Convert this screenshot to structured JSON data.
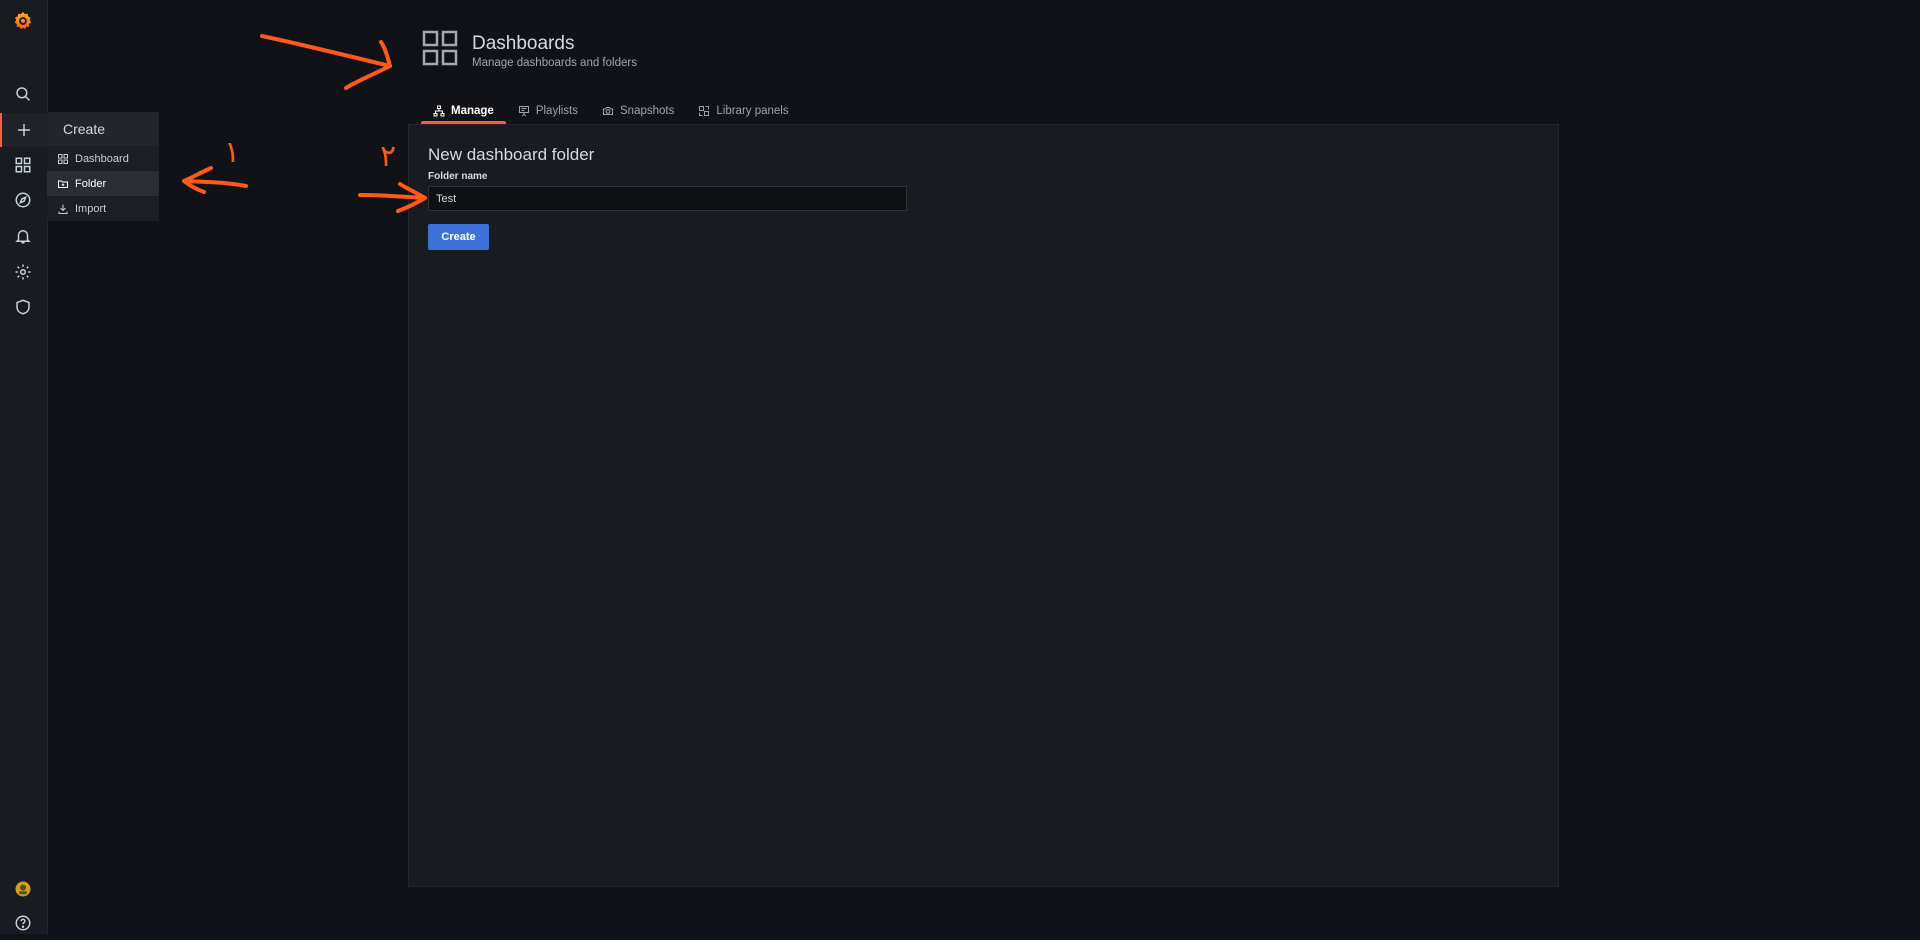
{
  "sidemenu": {
    "items": [
      {
        "name": "search",
        "icon": "search-icon"
      },
      {
        "name": "create",
        "icon": "plus-icon"
      },
      {
        "name": "dashboards",
        "icon": "apps-icon"
      },
      {
        "name": "explore",
        "icon": "compass-icon"
      },
      {
        "name": "alerting",
        "icon": "bell-icon"
      },
      {
        "name": "configuration",
        "icon": "gear-icon"
      },
      {
        "name": "server-admin",
        "icon": "shield-icon"
      }
    ],
    "accent": "#f55f3e"
  },
  "flyout": {
    "header": "Create",
    "items": [
      {
        "label": "Dashboard",
        "icon": "apps-icon"
      },
      {
        "label": "Folder",
        "icon": "folder-plus-icon"
      },
      {
        "label": "Import",
        "icon": "import-icon"
      }
    ]
  },
  "header": {
    "title": "Dashboards",
    "subtitle": "Manage dashboards and folders"
  },
  "tabs": [
    {
      "label": "Manage",
      "icon": "sitemap-icon",
      "active": true
    },
    {
      "label": "Playlists",
      "icon": "presentation-icon"
    },
    {
      "label": "Snapshots",
      "icon": "camera-icon"
    },
    {
      "label": "Library panels",
      "icon": "library-panel-icon"
    }
  ],
  "form": {
    "title": "New dashboard folder",
    "label": "Folder name",
    "value": "Test",
    "button": "Create"
  },
  "annotations": {
    "step1": "۱",
    "step2": "۲",
    "color": "#ff5a1a"
  },
  "colors": {
    "primary_button": "#3d71d9",
    "background": "#111217",
    "panel": "#181b1f"
  }
}
